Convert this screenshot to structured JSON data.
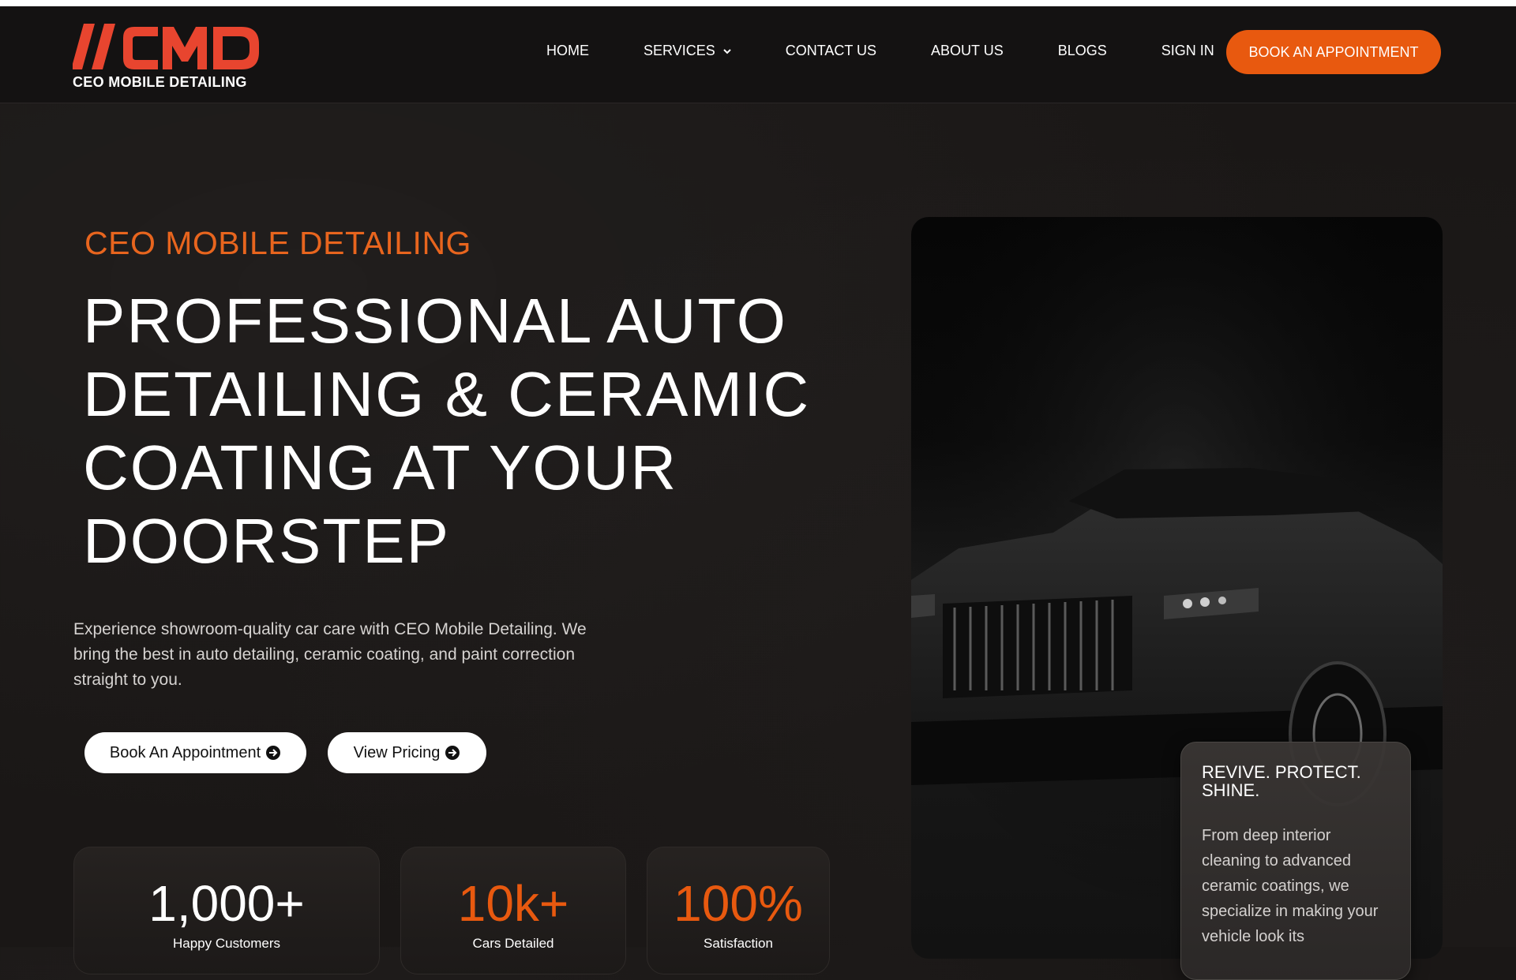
{
  "brand": {
    "logo_mark": "//CMD",
    "logo_text": "CEO MOBILE DETAILING",
    "accent": "#e8590f"
  },
  "nav": {
    "items": [
      {
        "label": "HOME"
      },
      {
        "label": "SERVICES",
        "icon": "chevron-down-icon"
      },
      {
        "label": "CONTACT US"
      },
      {
        "label": "ABOUT US"
      },
      {
        "label": "BLOGS"
      },
      {
        "label": "SIGN IN"
      }
    ],
    "cta": "BOOK AN APPOINTMENT"
  },
  "hero": {
    "eyebrow": "CEO MOBILE DETAILING",
    "headline_lines": [
      "PROFESSIONAL AUTO",
      "DETAILING & CERAMIC",
      "COATING AT YOUR",
      "DOORSTEP"
    ],
    "description": "Experience showroom-quality car care with CEO Mobile Detailing. We bring the best in auto detailing, ceramic coating, and paint correction straight to you.",
    "buttons": [
      {
        "label": "Book An Appointment",
        "icon": "arrow-circle-right-icon"
      },
      {
        "label": "View Pricing",
        "icon": "arrow-circle-right-icon"
      }
    ]
  },
  "stats": [
    {
      "value": "1,000+",
      "label": "Happy Customers"
    },
    {
      "value": "10k+",
      "label": "Cars Detailed"
    },
    {
      "value": "100%",
      "label": "Satisfaction"
    }
  ],
  "info_card": {
    "title": "REVIVE. PROTECT. SHINE.",
    "body": "From deep interior cleaning to advanced ceramic coatings, we specialize in making your vehicle look its"
  }
}
